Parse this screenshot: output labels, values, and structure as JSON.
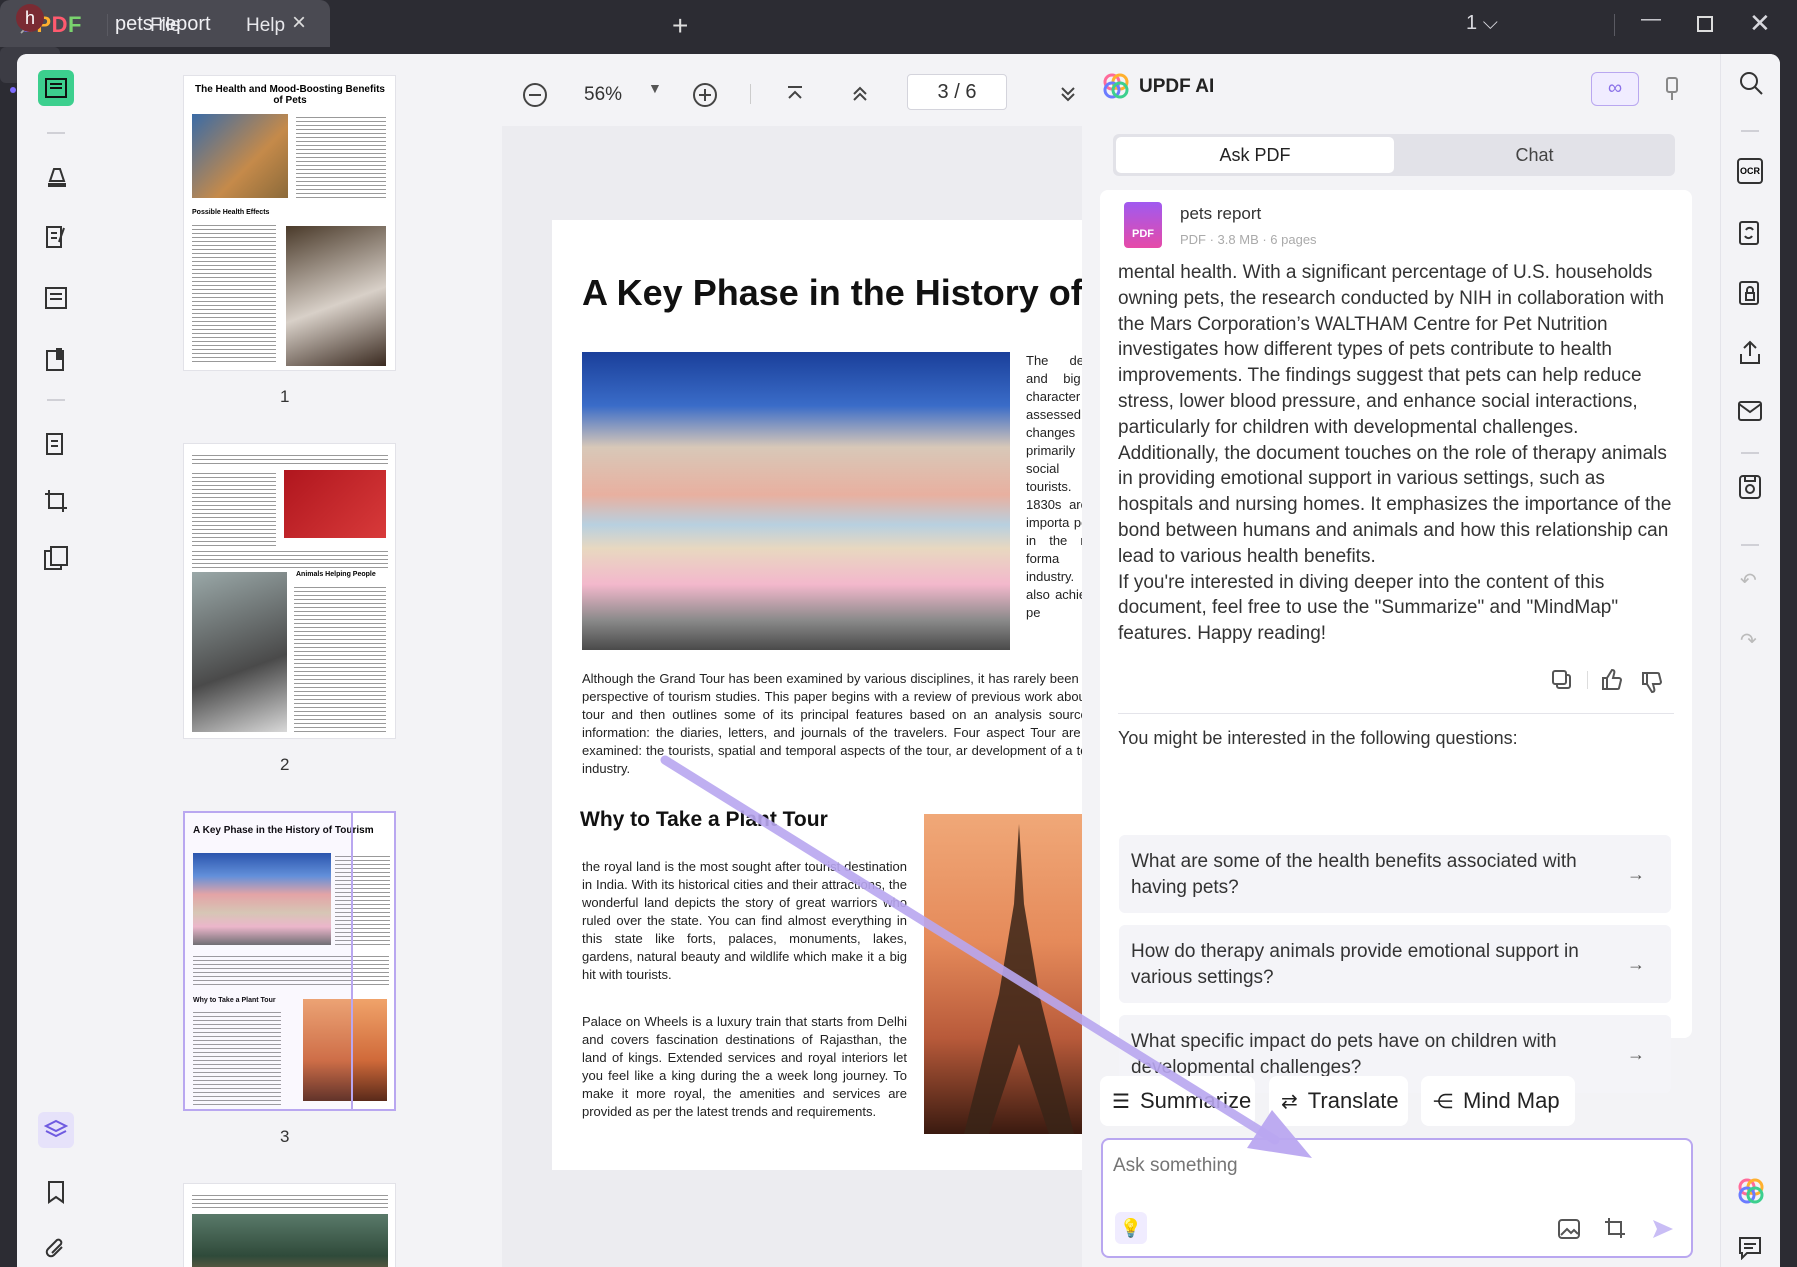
{
  "app": {
    "logo": "UPDF",
    "menu": [
      "File",
      "Help"
    ],
    "tab_title": "pets report",
    "page_count_badge": "1",
    "avatar_letter": "h"
  },
  "thumbnails": [
    {
      "number": "1",
      "title": "The Health and Mood-Boosting Benefits of Pets",
      "subhead": "Possible Health Effects"
    },
    {
      "number": "2",
      "subhead": "Animals Helping People"
    },
    {
      "number": "3",
      "title": "A Key Phase in the History of Tourism",
      "subhead": "Why to Take a Plant Tour"
    }
  ],
  "viewer": {
    "zoom": "56%",
    "page_indicator": "3 / 6",
    "doc_title": "A Key Phase in the History of To",
    "side_text": "The degree and big ch character o assessed ar changes a primarily to social cla tourists. Th 1830s are an importa period in the more forma industry. It is also achieving pe",
    "para1": "Although the Grand Tour has been examined by various disciplines, it has rarely been e the perspective of tourism studies. This paper begins with a review of previous work about the tour and then outlines some of its principal features based on an analysis sources of information: the diaries, letters, and journals of the travelers. Four aspect Tour are then examined: the tourists, spatial and temporal aspects of the tour, ar development of a tourist industry.",
    "subheading": "Why to Take a Plant Tour",
    "para2": "the royal land is the most sought after tourist destination in India. With its historical cities and their attractions, the wonderful land depicts the story of great warriors who ruled over the state. You can find almost everything in this state like forts, palaces, monuments, lakes, gardens, natural beauty and wildlife which make it a big hit with tourists.",
    "para3": "Palace on Wheels is a luxury train that starts from Delhi and covers fascination destinations of Rajasthan, the land of kings. Extended services and royal interiors let you feel like a king during the a week long journey. To make it more royal, the amenities and services are provided as per the latest trends and requirements."
  },
  "ai": {
    "title": "UPDF AI",
    "tabs": [
      "Ask PDF",
      "Chat"
    ],
    "file": {
      "name": "pets report",
      "meta": "PDF · 3.8 MB · 6 pages",
      "badge": "PDF"
    },
    "answer_p1": "mental health. With a significant percentage of U.S. households owning pets, the research conducted by NIH in collaboration with the Mars Corporation’s WALTHAM Centre for Pet Nutrition investigates how different types of pets contribute to health improvements. The findings suggest that pets can help reduce stress, lower blood pressure, and enhance social interactions, particularly for children with developmental challenges.",
    "answer_p2": "Additionally, the document touches on the role of therapy animals in providing emotional support in various settings, such as hospitals and nursing homes. It emphasizes the importance of the bond between humans and animals and how this relationship can lead to various health benefits.",
    "answer_p3": "If you're interested in diving deeper into the content of this document, feel free to use the \"Summarize\" and \"MindMap\" features. Happy reading!",
    "suggest_title": "You might be interested in the following questions:",
    "questions": [
      "What are some of the health benefits associated with having pets?",
      "How do therapy animals provide emotional support in various settings?",
      "What specific impact do pets have on children with developmental challenges?"
    ],
    "actions": [
      "Summarize",
      "Translate",
      "Mind Map"
    ],
    "input_placeholder": "Ask something"
  },
  "colors": {
    "accent": "#a98cff",
    "annotation_arrow": "#b9a7f0",
    "app_bg": "#f3f3f6",
    "titlebar": "#2c2c33"
  }
}
